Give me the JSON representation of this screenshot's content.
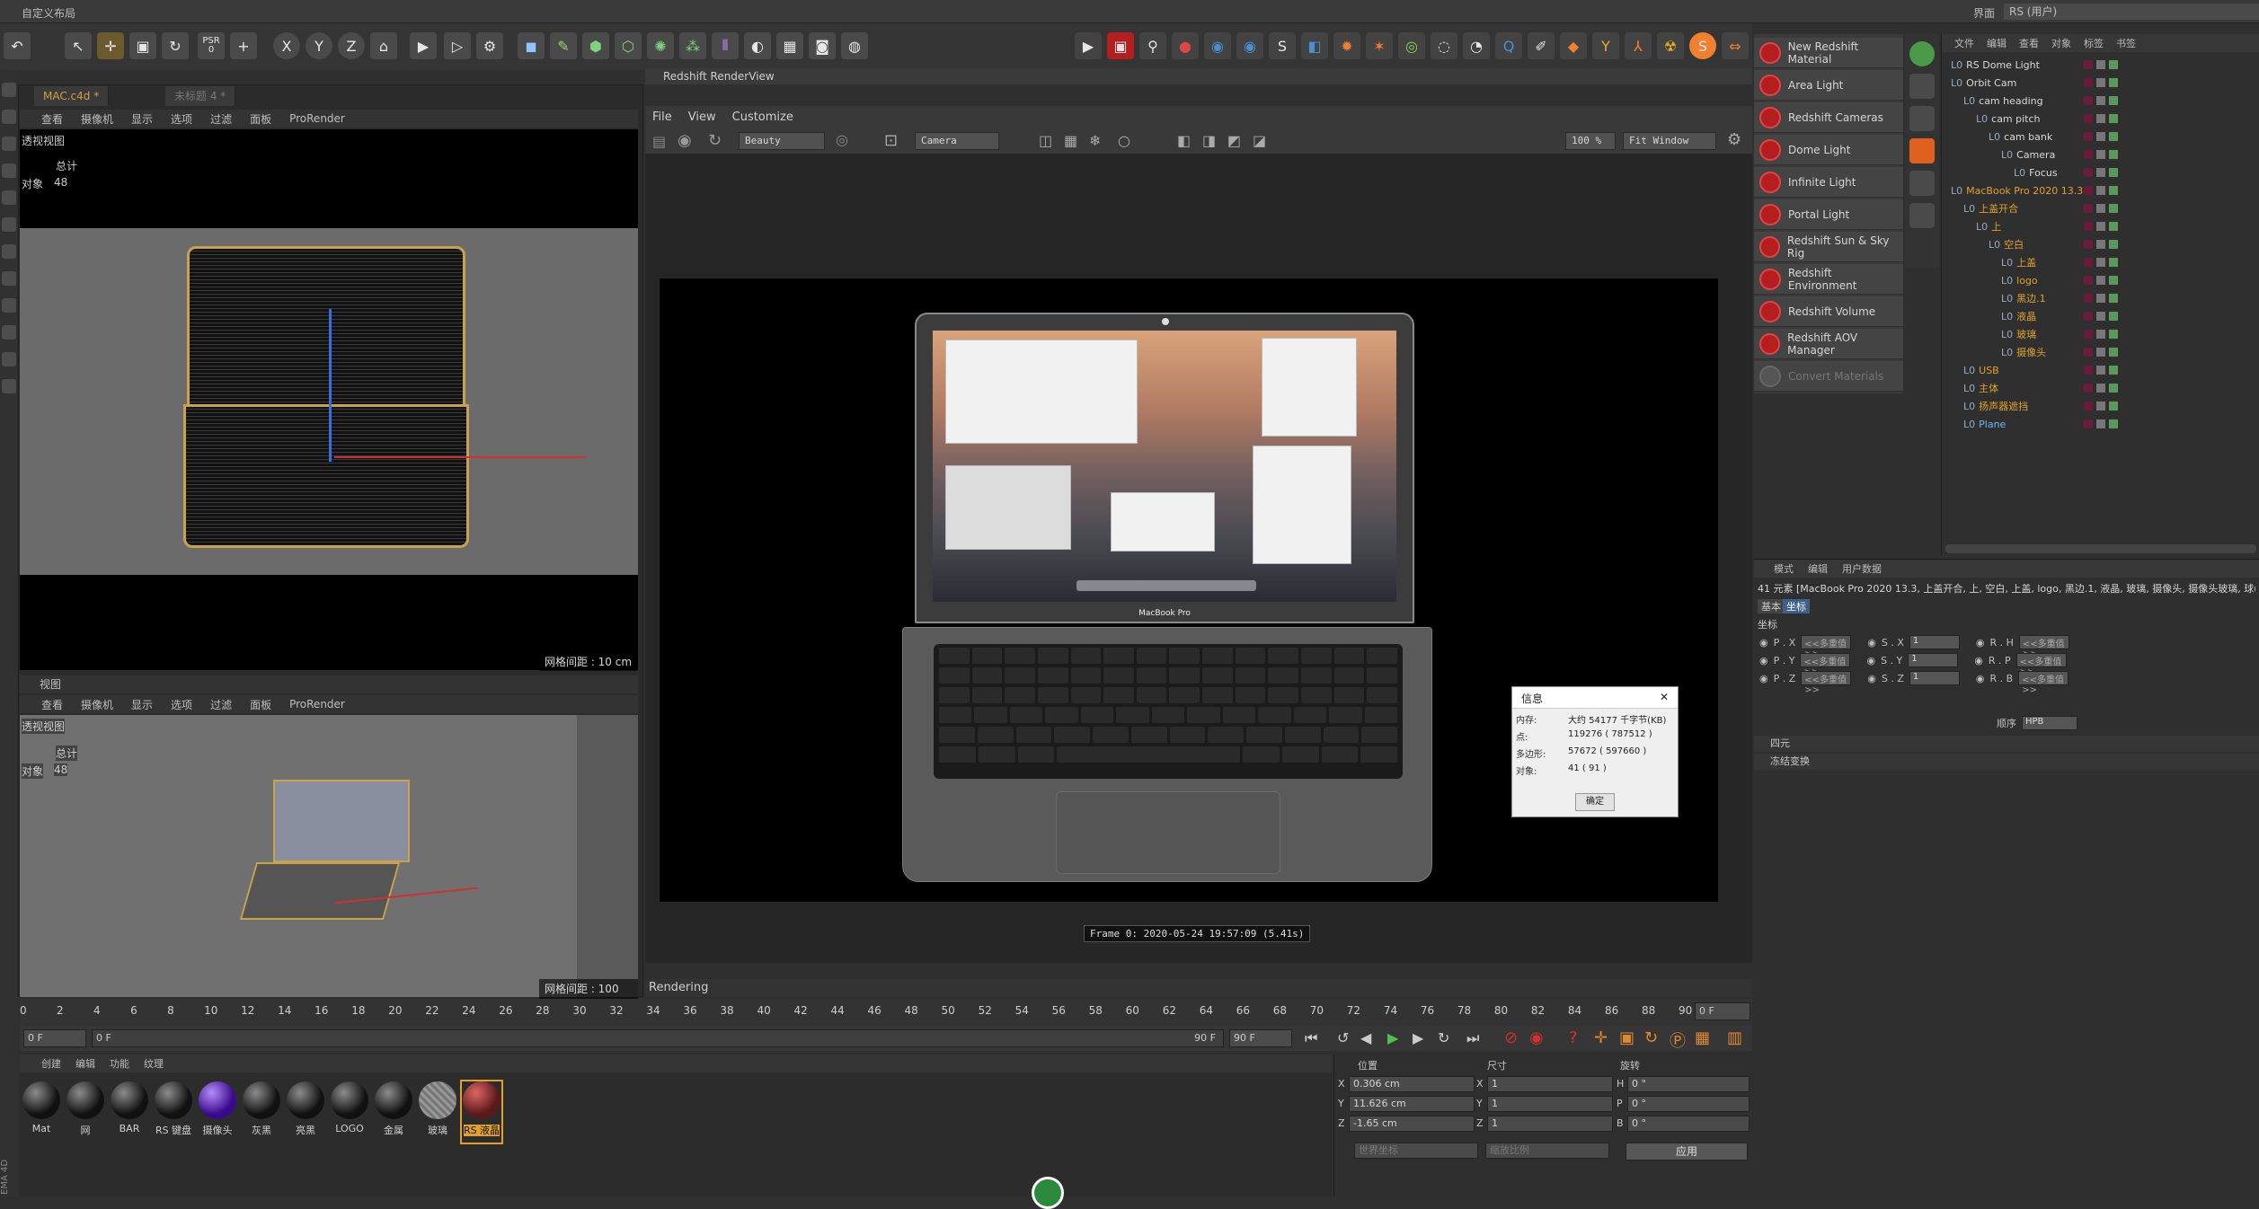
{
  "menu_bar": {
    "left_label": "自定义布局",
    "right_label": "界面",
    "right_value": "RS (用户)"
  },
  "toolbar": {
    "psr_label": "PSR",
    "psr_value": "0",
    "x_label": "X",
    "y_label": "Y",
    "z_label": "Z"
  },
  "left_panel": {
    "tabs": [
      "MAC.c4d *",
      "未标题 4 *"
    ],
    "viewport_menu": [
      "查看",
      "摄像机",
      "显示",
      "选项",
      "过滤",
      "面板",
      "ProRender"
    ],
    "viewport1": {
      "title": "透视视图",
      "stat_label": "总计",
      "objects_label": "对象",
      "objects_value": "48",
      "grid_note": "网格间距 : 10 cm"
    },
    "viewport2_header": "视图",
    "viewport2": {
      "title": "透视视图",
      "stat_label": "总计",
      "objects_label": "对象",
      "objects_value": "48",
      "grid_note": "网格间距 : 100 cm"
    }
  },
  "renderview": {
    "title": "Redshift RenderView",
    "menu": [
      "File",
      "View",
      "Customize"
    ],
    "aov": "Beauty",
    "camera": "Camera",
    "zoom": "100 %",
    "fit": "Fit Window",
    "frame_info": "Frame  0:  2020-05-24  19:57:09  (5.41s)",
    "status": "Rendering",
    "screen_brand": "MacBook Pro"
  },
  "info_dialog": {
    "title": "信息",
    "rows": [
      {
        "label": "内存:",
        "value": "大约 54177 千字节(KB)"
      },
      {
        "label": "点:",
        "value": "119276 ( 787512 )"
      },
      {
        "label": "多边形:",
        "value": "57672 ( 597660 )"
      },
      {
        "label": "对象:",
        "value": "41 ( 91 )"
      }
    ],
    "ok": "确定"
  },
  "redshift_menu": [
    {
      "label": "New Redshift Material",
      "enabled": true
    },
    {
      "label": "Area Light",
      "enabled": true
    },
    {
      "label": "Redshift Cameras",
      "enabled": true
    },
    {
      "label": "Dome Light",
      "enabled": true
    },
    {
      "label": "Infinite Light",
      "enabled": true
    },
    {
      "label": "Portal Light",
      "enabled": true
    },
    {
      "label": "Redshift Sun & Sky Rig",
      "enabled": true
    },
    {
      "label": "Redshift Environment",
      "enabled": true
    },
    {
      "label": "Redshift Volume",
      "enabled": true
    },
    {
      "label": "Redshift AOV Manager",
      "enabled": true
    },
    {
      "label": "Convert Materials",
      "enabled": false
    }
  ],
  "object_manager": {
    "menu": [
      "文件",
      "编辑",
      "查看",
      "对象",
      "标签",
      "书签"
    ],
    "objects": [
      {
        "name": "RS Dome Light",
        "depth": 0,
        "color": "w"
      },
      {
        "name": "Orbit Cam",
        "depth": 0,
        "color": "w"
      },
      {
        "name": "cam heading",
        "depth": 1,
        "color": "w"
      },
      {
        "name": "cam pitch",
        "depth": 2,
        "color": "w"
      },
      {
        "name": "cam bank",
        "depth": 3,
        "color": "w"
      },
      {
        "name": "Camera",
        "depth": 4,
        "color": "w"
      },
      {
        "name": "Focus",
        "depth": 5,
        "color": "w"
      },
      {
        "name": "MacBook Pro 2020 13.3",
        "depth": 0,
        "color": "y"
      },
      {
        "name": "上盖开合",
        "depth": 1,
        "color": "y"
      },
      {
        "name": "上",
        "depth": 2,
        "color": "y"
      },
      {
        "name": "空白",
        "depth": 3,
        "color": "y"
      },
      {
        "name": "上盖",
        "depth": 4,
        "color": "y"
      },
      {
        "name": "logo",
        "depth": 4,
        "color": "y"
      },
      {
        "name": "黑边.1",
        "depth": 4,
        "color": "y"
      },
      {
        "name": "液晶",
        "depth": 4,
        "color": "y"
      },
      {
        "name": "玻璃",
        "depth": 4,
        "color": "y"
      },
      {
        "name": "摄像头",
        "depth": 4,
        "color": "y"
      },
      {
        "name": "USB",
        "depth": 1,
        "color": "y"
      },
      {
        "name": "主体",
        "depth": 1,
        "color": "y"
      },
      {
        "name": "扬声器遮挡",
        "depth": 1,
        "color": "y"
      },
      {
        "name": "Plane",
        "depth": 1,
        "color": "b"
      }
    ]
  },
  "attributes": {
    "menu": [
      "模式",
      "编辑",
      "用户数据"
    ],
    "selection_text": "41 元素 [MacBook Pro 2020 13.3, 上盖开合, 上, 空白, 上盖, logo, 黑边.1, 液晶, 玻璃, 摄像头, 摄像头玻璃, 球(",
    "tabs": [
      "基本",
      "坐标"
    ],
    "section": "坐标",
    "rows": [
      {
        "p": "P . X",
        "pv": "<<多重值>>",
        "s": "S . X",
        "sv": "1",
        "r": "R . H",
        "rv": "<<多重值>>"
      },
      {
        "p": "P . Y",
        "pv": "<<多重值>>",
        "s": "S . Y",
        "sv": "1",
        "r": "R . P",
        "rv": "<<多重值>>"
      },
      {
        "p": "P . Z",
        "pv": "<<多重值>>",
        "s": "S . Z",
        "sv": "1",
        "r": "R . B",
        "rv": "<<多重值>>"
      }
    ],
    "order_label": "顺序",
    "order_value": "HPB",
    "collapsed": [
      "四元",
      "冻结变换"
    ]
  },
  "timeline": {
    "ticks": [
      "0",
      "2",
      "4",
      "6",
      "8",
      "10",
      "12",
      "14",
      "16",
      "18",
      "20",
      "22",
      "24",
      "26",
      "28",
      "30",
      "32",
      "34",
      "36",
      "38",
      "40",
      "42",
      "44",
      "46",
      "48",
      "50",
      "52",
      "54",
      "56",
      "58",
      "60",
      "62",
      "64",
      "66",
      "68",
      "70",
      "72",
      "74",
      "76",
      "78",
      "80",
      "82",
      "84",
      "86",
      "88",
      "90"
    ],
    "current_frame": "0 F",
    "start": "0 F",
    "min": "0 F",
    "max_label": "90 F",
    "end": "90 F"
  },
  "materials": {
    "menu": [
      "创建",
      "编辑",
      "功能",
      "纹理"
    ],
    "items": [
      "Mat",
      "网",
      "BAR",
      "RS 键盘",
      "摄像头",
      "灰黑",
      "亮黑",
      "LOGO",
      "金属",
      "玻璃",
      "RS 液晶"
    ]
  },
  "coordinates": {
    "headers": [
      "位置",
      "尺寸",
      "旋转"
    ],
    "rows": [
      {
        "axis": "X",
        "pos": "0.306 cm",
        "size": "1",
        "rl": "H",
        "rot": "0 °"
      },
      {
        "axis": "Y",
        "pos": "11.626 cm",
        "size": "1",
        "rl": "P",
        "rot": "0 °"
      },
      {
        "axis": "Z",
        "pos": "-1.65 cm",
        "size": "1",
        "rl": "B",
        "rot": "0 °"
      }
    ],
    "mode1": "世界坐标",
    "mode2": "缩放比例",
    "apply": "应用"
  },
  "app_side_label": "EMA 4D",
  "colors": {
    "accent": "#e0a22d",
    "redshift": "#b51e1e",
    "object_blue": "#6db8f2"
  }
}
